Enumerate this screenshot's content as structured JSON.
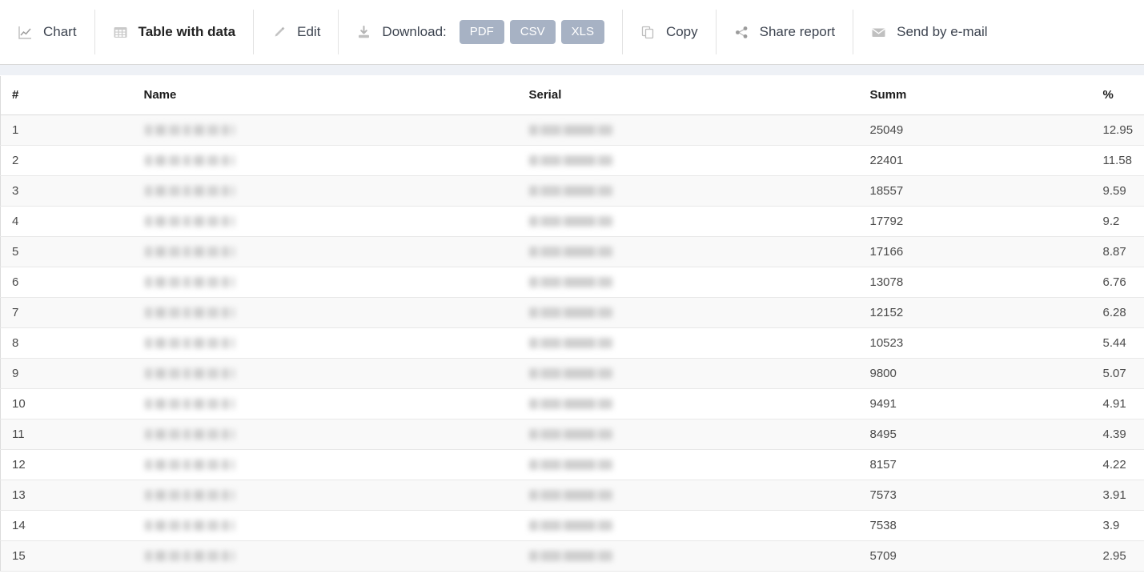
{
  "toolbar": {
    "groups": [
      {
        "items": [
          {
            "id": "chart",
            "icon": "line-chart-icon",
            "label": "Chart",
            "active": false
          }
        ]
      },
      {
        "items": [
          {
            "id": "table",
            "icon": "grid-table-icon",
            "label": "Table with data",
            "active": true
          }
        ]
      },
      {
        "items": [
          {
            "id": "edit",
            "icon": "pencil-icon",
            "label": "Edit",
            "active": false
          }
        ]
      },
      {
        "items": [
          {
            "id": "download",
            "icon": "download-icon",
            "label": "Download:",
            "active": false
          }
        ]
      },
      {
        "items": [
          {
            "id": "copy",
            "icon": "copy-icon",
            "label": "Copy",
            "active": false
          }
        ]
      },
      {
        "items": [
          {
            "id": "share",
            "icon": "share-nodes-icon",
            "label": "Share report",
            "active": false
          }
        ]
      },
      {
        "items": [
          {
            "id": "email",
            "icon": "envelope-icon",
            "label": "Send by e-mail",
            "active": false
          }
        ]
      }
    ],
    "download_buttons": [
      {
        "id": "pdf",
        "label": "PDF"
      },
      {
        "id": "csv",
        "label": "CSV"
      },
      {
        "id": "xls",
        "label": "XLS"
      }
    ]
  },
  "colors": {
    "download_button_bg": "#a7b2c4",
    "download_button_text": "#ffffff",
    "band": "#eef1f6",
    "row_stripe": "#f9f9f9",
    "text": "#4a4a4a",
    "icon": "#b7b7b7"
  },
  "table": {
    "columns": [
      {
        "key": "index",
        "label": "#"
      },
      {
        "key": "name",
        "label": "Name"
      },
      {
        "key": "serial",
        "label": "Serial"
      },
      {
        "key": "summ",
        "label": "Summ"
      },
      {
        "key": "percent",
        "label": "%"
      }
    ],
    "rows": [
      {
        "index": "1",
        "name": "",
        "serial": "",
        "summ": "25049",
        "percent": "12.95",
        "redacted": true
      },
      {
        "index": "2",
        "name": "",
        "serial": "",
        "summ": "22401",
        "percent": "11.58",
        "redacted": true
      },
      {
        "index": "3",
        "name": "",
        "serial": "",
        "summ": "18557",
        "percent": "9.59",
        "redacted": true
      },
      {
        "index": "4",
        "name": "",
        "serial": "",
        "summ": "17792",
        "percent": "9.2",
        "redacted": true
      },
      {
        "index": "5",
        "name": "",
        "serial": "",
        "summ": "17166",
        "percent": "8.87",
        "redacted": true
      },
      {
        "index": "6",
        "name": "",
        "serial": "",
        "summ": "13078",
        "percent": "6.76",
        "redacted": true
      },
      {
        "index": "7",
        "name": "",
        "serial": "",
        "summ": "12152",
        "percent": "6.28",
        "redacted": true
      },
      {
        "index": "8",
        "name": "",
        "serial": "",
        "summ": "10523",
        "percent": "5.44",
        "redacted": true
      },
      {
        "index": "9",
        "name": "",
        "serial": "",
        "summ": "9800",
        "percent": "5.07",
        "redacted": true
      },
      {
        "index": "10",
        "name": "",
        "serial": "",
        "summ": "9491",
        "percent": "4.91",
        "redacted": true
      },
      {
        "index": "11",
        "name": "",
        "serial": "",
        "summ": "8495",
        "percent": "4.39",
        "redacted": true
      },
      {
        "index": "12",
        "name": "",
        "serial": "",
        "summ": "8157",
        "percent": "4.22",
        "redacted": true
      },
      {
        "index": "13",
        "name": "",
        "serial": "",
        "summ": "7573",
        "percent": "3.91",
        "redacted": true
      },
      {
        "index": "14",
        "name": "",
        "serial": "",
        "summ": "7538",
        "percent": "3.9",
        "redacted": true
      },
      {
        "index": "15",
        "name": "",
        "serial": "",
        "summ": "5709",
        "percent": "2.95",
        "redacted": true
      }
    ]
  }
}
